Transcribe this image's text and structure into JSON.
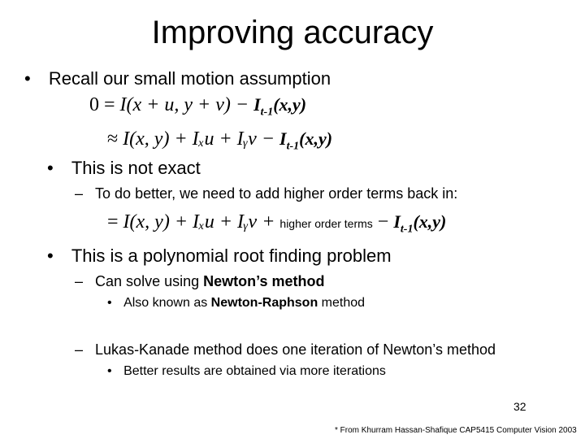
{
  "slide": {
    "title": "Improving accuracy",
    "bullets": [
      {
        "level": 1,
        "text": "Recall our small motion assumption"
      },
      {
        "level": 1,
        "text": "This is not exact"
      },
      {
        "level": 2,
        "text": "To do better, we need to add higher order terms back in:"
      },
      {
        "level": 1,
        "text": "This is a polynomial root finding problem"
      },
      {
        "level": 2,
        "pre": "Can solve using ",
        "bold": "Newton’s method"
      },
      {
        "level": 3,
        "pre": "Also known as ",
        "bold": "Newton-Raphson",
        "post": " method"
      },
      {
        "level": 2,
        "text": "Lukas-Kanade method does one iteration of Newton’s method"
      },
      {
        "level": 3,
        "text": "Better results are obtained via more iterations"
      }
    ],
    "equations": {
      "eq1": {
        "lhs": "0 =",
        "body": "I(x + u, y + v) −",
        "tail_main": "I",
        "tail_sub": "t-1",
        "tail_args": "(x,y)"
      },
      "eq2": {
        "lhs": "≈",
        "body": "I(x, y) + Iₓu + Iᵧv −",
        "tail_main": "I",
        "tail_sub": "t-1",
        "tail_args": "(x,y)"
      },
      "eq3": {
        "lhs": "=",
        "body": "I(x, y) + Iₓu + Iᵧv +",
        "hot": "higher order terms",
        "minus": "−",
        "tail_main": "I",
        "tail_sub": "t-1",
        "tail_args": "(x,y)"
      }
    },
    "bullet_glyphs": {
      "l1": "•",
      "l2": "–",
      "l3": "•"
    },
    "page_number": "32",
    "footnote": "* From Khurram Hassan-Shafique CAP5415 Computer Vision 2003"
  }
}
